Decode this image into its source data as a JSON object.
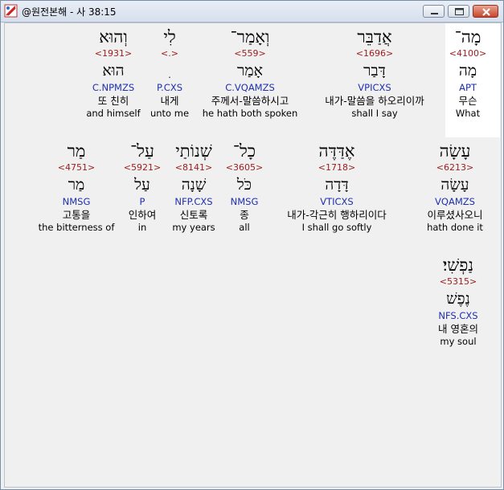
{
  "window": {
    "title": "@원전본해 - 사 38:15",
    "minimize_label": "minimize",
    "maximize_label": "maximize",
    "close_label": "close"
  },
  "rows": [
    [
      {
        "hebrew": "מָה־",
        "strong": "<4100>",
        "lemma": "מָה",
        "morph": "APT",
        "korean": "무슨",
        "english": "What",
        "highlighted": true
      },
      {
        "hebrew": "אֲדַבֵּר",
        "strong": "<1696>",
        "lemma": "דָּבַר",
        "morph": "VPICXS",
        "korean": "내가-말씀을 하오리이까",
        "english": "shall I say"
      },
      {
        "hebrew": "וְאָמַר־",
        "strong": "<559>",
        "lemma": "אָמַר",
        "morph": "C.VQAMZS",
        "korean": "주께서-말씀하시고",
        "english": "he hath both spoken"
      },
      {
        "hebrew": "לִי",
        "strong": "<.>",
        "lemma": "ִ",
        "morph": "P.CXS",
        "korean": "내게",
        "english": "unto me"
      },
      {
        "hebrew": "וְהוּא",
        "strong": "<1931>",
        "lemma": "הוּא",
        "morph": "C.NPMZS",
        "korean": "또 친히",
        "english": "and himself"
      }
    ],
    [
      {
        "hebrew": "עָשָׂה",
        "strong": "<6213>",
        "lemma": "עָשָׂה",
        "morph": "VQAMZS",
        "korean": "이루셨사오니",
        "english": "hath done it"
      },
      {
        "hebrew": "אֶדַּדֶּה",
        "strong": "<1718>",
        "lemma": "דָּדָה",
        "morph": "VTICXS",
        "korean": "내가-각근히 행하리이다",
        "english": "I shall go softly"
      },
      {
        "hebrew": "כָל־",
        "strong": "<3605>",
        "lemma": "כֹּל",
        "morph": "NMSG",
        "korean": "종",
        "english": "all"
      },
      {
        "hebrew": "שְׁנוֹתַי",
        "strong": "<8141>",
        "lemma": "שָׁנָה",
        "morph": "NFP.CXS",
        "korean": "신토록",
        "english": "my years"
      },
      {
        "hebrew": "עַל־",
        "strong": "<5921>",
        "lemma": "עַל",
        "morph": "P",
        "korean": "인하여",
        "english": "in"
      },
      {
        "hebrew": "מַר",
        "strong": "<4751>",
        "lemma": "מַר",
        "morph": "NMSG",
        "korean": "고통을",
        "english": "the bitterness of"
      }
    ],
    [
      {
        "hebrew": "נַפְשִׁי׃",
        "strong": "<5315>",
        "lemma": "נֶפֶשׁ",
        "morph": "NFS.CXS",
        "korean": "내 영혼의",
        "english": "my soul"
      }
    ]
  ]
}
